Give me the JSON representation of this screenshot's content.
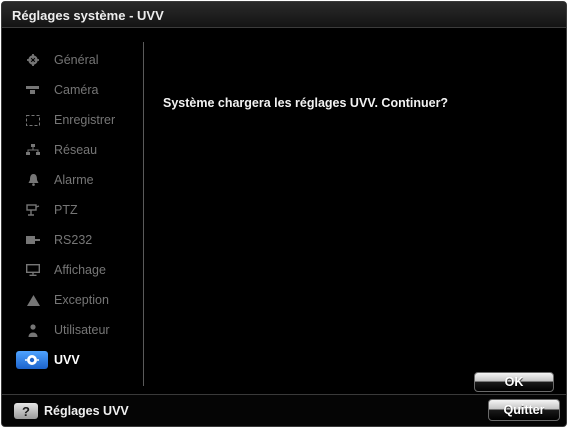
{
  "window": {
    "title": "Réglages système - UVV"
  },
  "sidebar": {
    "items": [
      {
        "label": "Général",
        "icon": "gear-icon"
      },
      {
        "label": "Caméra",
        "icon": "camera-icon"
      },
      {
        "label": "Enregistrer",
        "icon": "record-icon"
      },
      {
        "label": "Réseau",
        "icon": "network-icon"
      },
      {
        "label": "Alarme",
        "icon": "bell-icon"
      },
      {
        "label": "PTZ",
        "icon": "ptz-icon"
      },
      {
        "label": "RS232",
        "icon": "serial-port-icon"
      },
      {
        "label": "Affichage",
        "icon": "monitor-icon"
      },
      {
        "label": "Exception",
        "icon": "warning-icon"
      },
      {
        "label": "Utilisateur",
        "icon": "user-icon"
      },
      {
        "label": "UVV",
        "icon": "uvv-icon",
        "active": true
      }
    ]
  },
  "main": {
    "message": "Système chargera les réglages UVV. Continuer?"
  },
  "buttons": {
    "ok_label": "OK",
    "quit_label": "Quitter"
  },
  "footer": {
    "help_label": "Réglages UVV",
    "help_icon": "?"
  },
  "colors": {
    "accent": "#2a7be8",
    "background": "#000000",
    "inactive_text": "#767676"
  }
}
